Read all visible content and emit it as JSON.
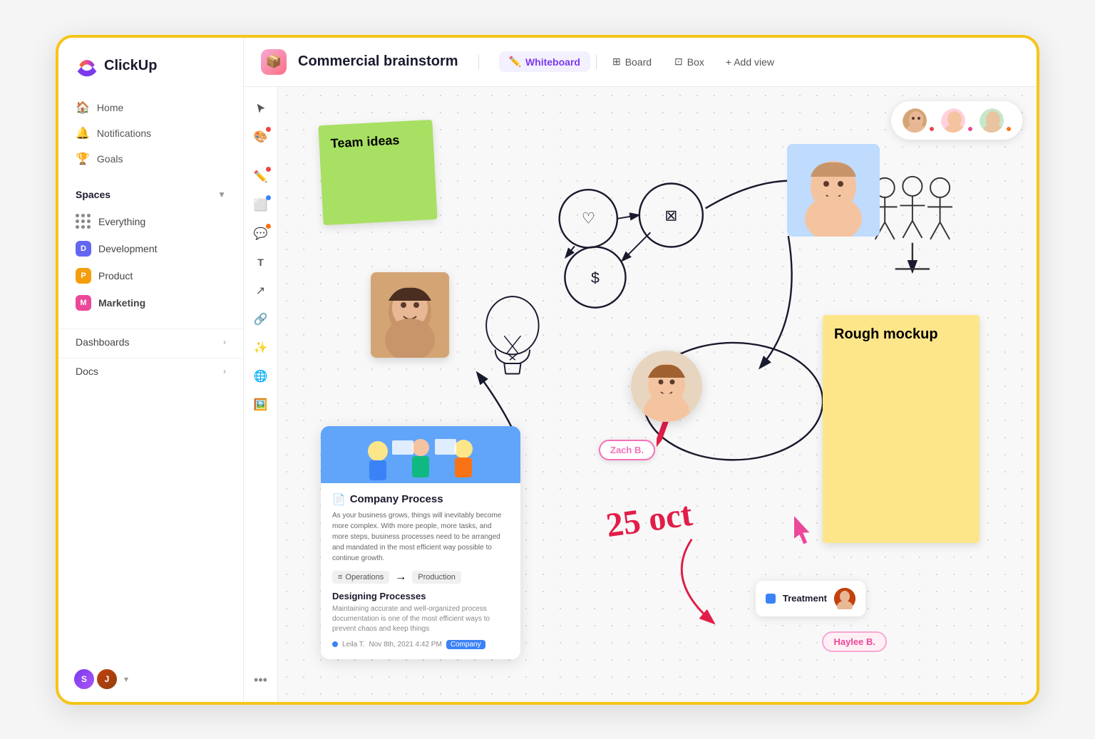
{
  "app": {
    "name": "ClickUp"
  },
  "sidebar": {
    "nav_items": [
      {
        "label": "Home",
        "icon": "🏠"
      },
      {
        "label": "Notifications",
        "icon": "🔔"
      },
      {
        "label": "Goals",
        "icon": "🏆"
      }
    ],
    "spaces_section": "Spaces",
    "spaces": [
      {
        "label": "Everything",
        "type": "grid"
      },
      {
        "label": "Development",
        "color": "#6366f1",
        "initial": "D"
      },
      {
        "label": "Product",
        "color": "#f59e0b",
        "initial": "P"
      },
      {
        "label": "Marketing",
        "color": "#ec4899",
        "initial": "M",
        "bold": true
      }
    ],
    "dashboards_label": "Dashboards",
    "docs_label": "Docs"
  },
  "topbar": {
    "workspace_title": "Commercial brainstorm",
    "views": [
      {
        "label": "Whiteboard",
        "active": true,
        "icon": "✏️"
      },
      {
        "label": "Board",
        "active": false,
        "icon": "⊞"
      },
      {
        "label": "Box",
        "active": false,
        "icon": "⊡"
      }
    ],
    "add_view_label": "+ Add view"
  },
  "canvas": {
    "sticky_green_text": "Team ideas",
    "sticky_yellow_text": "Rough mockup",
    "date_text": "25 oct",
    "badge_zach": "Zach B.",
    "badge_haylee": "Haylee B.",
    "treatment_label": "Treatment"
  },
  "doc_card": {
    "title": "Company Process",
    "description": "As your business grows, things will inevitably become more complex. With more people, more tasks, and more steps, business processes need to be arranged and mandated in the most efficient way possible to continue growth.",
    "tag1": "Operations",
    "tag2": "Production",
    "section_title": "Designing Processes",
    "section_text": "Maintaining accurate and well-organized process documentation is one of the most efficient ways to prevent chaos and keep things",
    "author": "Leila T.",
    "date": "Nov 8th, 2021  4:42 PM",
    "badge": "Company"
  },
  "people_icons": {
    "label": "👥👥👥"
  },
  "colors": {
    "active_tab": "#7c3aed",
    "logo_gradient_start": "#f97316",
    "sticky_green": "#a8e063",
    "sticky_yellow": "#fde68a"
  }
}
